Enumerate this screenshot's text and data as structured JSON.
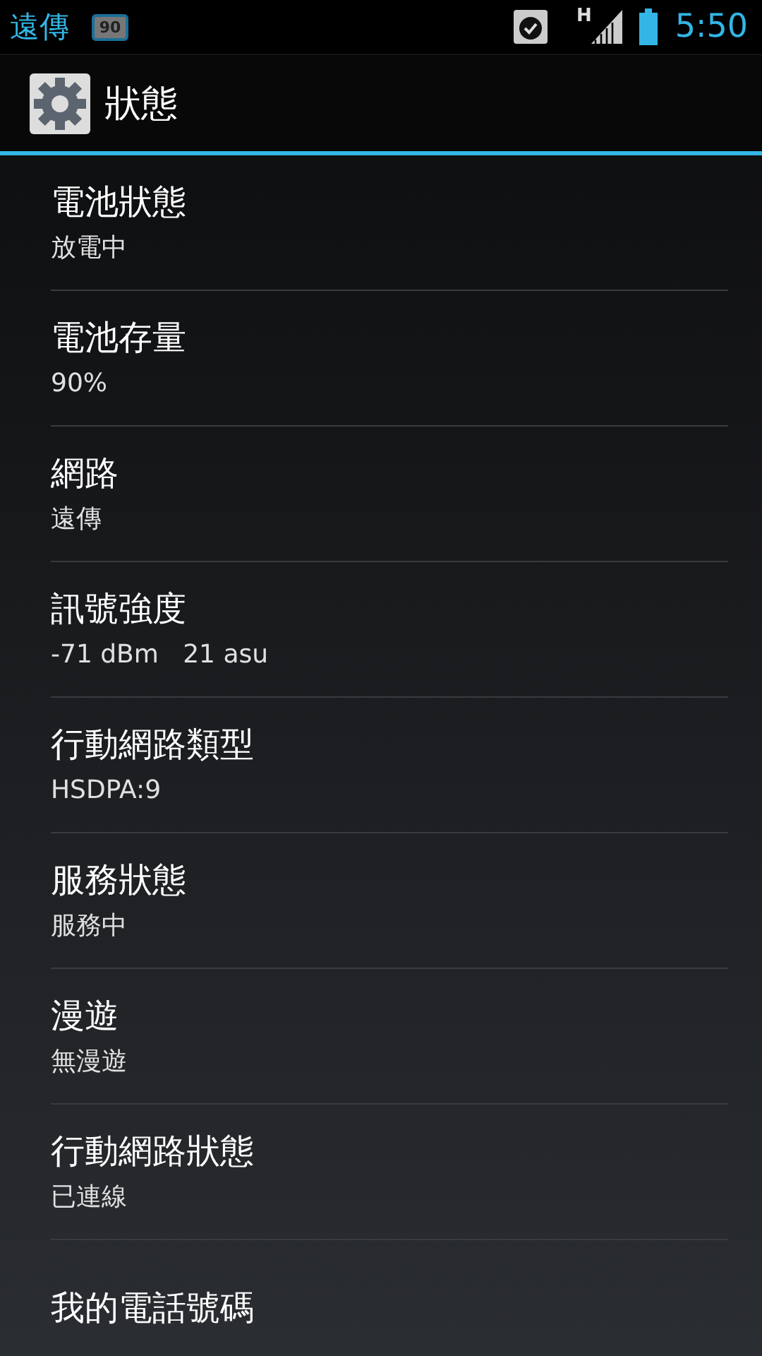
{
  "status_bar": {
    "carrier": "遠傳",
    "badge": "90",
    "network_type": "H",
    "time": "5:50"
  },
  "action_bar": {
    "title": "狀態"
  },
  "items": [
    {
      "title": "電池狀態",
      "summary": "放電中"
    },
    {
      "title": "電池存量",
      "summary": "90%"
    },
    {
      "title": "網路",
      "summary": "遠傳"
    },
    {
      "title": "訊號強度",
      "summary": "-71 dBm   21 asu"
    },
    {
      "title": "行動網路類型",
      "summary": "HSDPA:9"
    },
    {
      "title": "服務狀態",
      "summary": "服務中"
    },
    {
      "title": "漫遊",
      "summary": "無漫遊"
    },
    {
      "title": "行動網路狀態",
      "summary": "已連線"
    },
    {
      "title": "我的電話號碼"
    }
  ]
}
